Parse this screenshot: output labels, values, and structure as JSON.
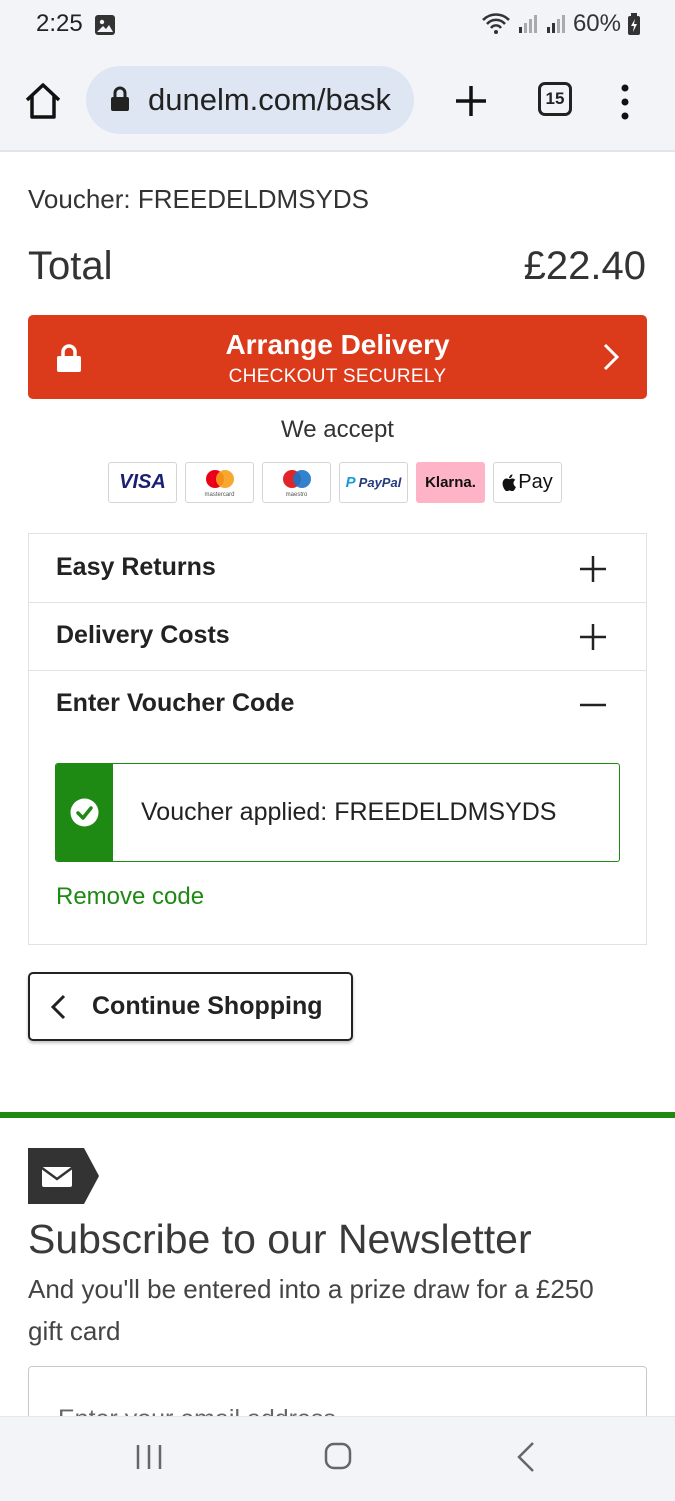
{
  "status_bar": {
    "time": "2:25",
    "battery": "60%"
  },
  "browser": {
    "url": "dunelm.com/bask",
    "tab_count": "15"
  },
  "summary": {
    "voucher_line": "Voucher: FREEDELDMSYDS",
    "total_label": "Total",
    "total_value": "£22.40"
  },
  "checkout": {
    "title": "Arrange Delivery",
    "subtitle": "CHECKOUT SECURELY"
  },
  "payments": {
    "heading": "We accept",
    "methods": [
      "VISA",
      "mastercard",
      "maestro",
      "PayPal",
      "Klarna.",
      "Pay"
    ]
  },
  "accordion": {
    "items": [
      {
        "label": "Easy Returns",
        "state": "collapsed"
      },
      {
        "label": "Delivery Costs",
        "state": "collapsed"
      },
      {
        "label": "Enter Voucher Code",
        "state": "expanded"
      }
    ],
    "voucher_applied": "Voucher applied: FREEDELDMSYDS",
    "remove_code": "Remove code"
  },
  "continue_shopping": "Continue Shopping",
  "newsletter": {
    "title": "Subscribe to our Newsletter",
    "subtitle": "And you'll be entered into a prize draw for a £250 gift card",
    "email_placeholder": "Enter your email address"
  },
  "colors": {
    "checkout_red": "#db3a1b",
    "success_green": "#1f8a13",
    "klarna_pink": "#ffb3c7"
  }
}
